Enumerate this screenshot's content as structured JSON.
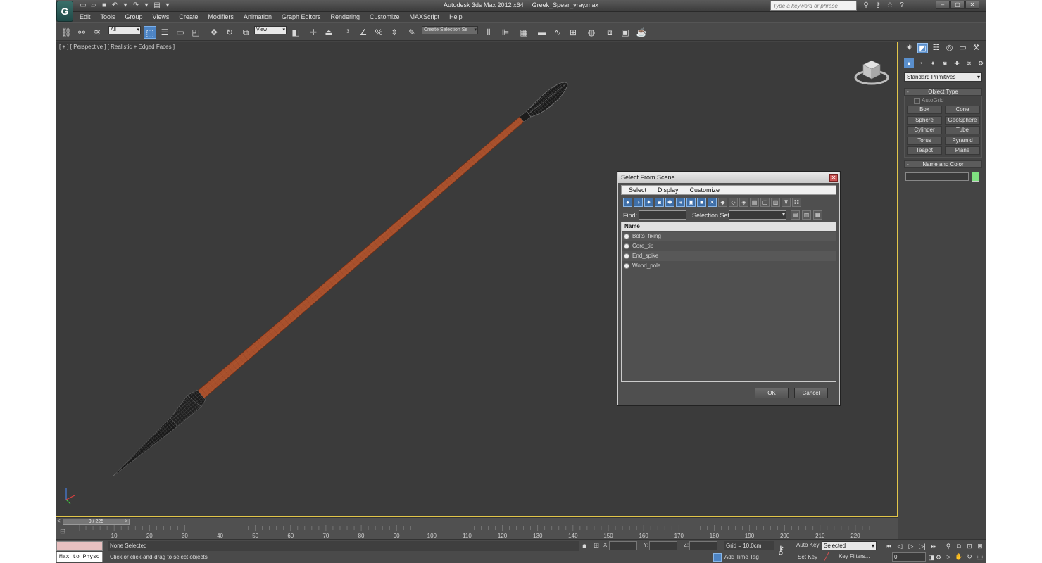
{
  "app": {
    "title_app": "Autodesk 3ds Max 2012 x64",
    "title_file": "Greek_Spear_vray.max",
    "logo_icon": "3dsmax-logo-icon",
    "search_placeholder": "Type a keyword or phrase"
  },
  "menu": [
    "Edit",
    "Tools",
    "Group",
    "Views",
    "Create",
    "Modifiers",
    "Animation",
    "Graph Editors",
    "Rendering",
    "Customize",
    "MAXScript",
    "Help"
  ],
  "toolbar": {
    "filter_value": "All",
    "refcoord_value": "View",
    "named_selection_placeholder": "Create Selection Se"
  },
  "viewport": {
    "label": "[ + ] [ Perspective ] [ Realistic + Edged Faces ]",
    "border_color": "#e2c64a",
    "shaft_color": "#a8502c",
    "metal_color": "#1a1a1a"
  },
  "dialog": {
    "title": "Select From Scene",
    "menu": [
      "Select",
      "Display",
      "Customize"
    ],
    "find_label": "Find:",
    "selection_set_label": "Selection Set:",
    "column_name": "Name",
    "items": [
      "Bolts_fixing",
      "Core_tip",
      "End_spike",
      "Wood_pole"
    ],
    "ok": "OK",
    "cancel": "Cancel"
  },
  "command_panel": {
    "dropdown": "Standard Primitives",
    "object_type_title": "Object Type",
    "autogrid": "AutoGrid",
    "primitives": [
      "Box",
      "Cone",
      "Sphere",
      "GeoSphere",
      "Cylinder",
      "Tube",
      "Torus",
      "Pyramid",
      "Teapot",
      "Plane"
    ],
    "name_color_title": "Name and Color",
    "object_color": "#7fe080"
  },
  "timeline": {
    "frame_display": "0 / 225",
    "ticks": [
      "10",
      "20",
      "30",
      "40",
      "50",
      "60",
      "70",
      "80",
      "90",
      "100",
      "110",
      "120",
      "130",
      "140",
      "150",
      "160",
      "170",
      "180",
      "190",
      "200",
      "210",
      "220"
    ]
  },
  "status": {
    "maxscript": "Max to Physc",
    "selection": "None Selected",
    "prompt": "Click or click-and-drag to select objects",
    "x_label": "X:",
    "y_label": "Y:",
    "z_label": "Z:",
    "grid": "Grid = 10,0cm",
    "add_time_tag": "Add Time Tag",
    "auto_key": "Auto Key",
    "set_key": "Set Key",
    "key_mode": "Selected",
    "key_filters": "Key Filters...",
    "current_frame": "0"
  }
}
